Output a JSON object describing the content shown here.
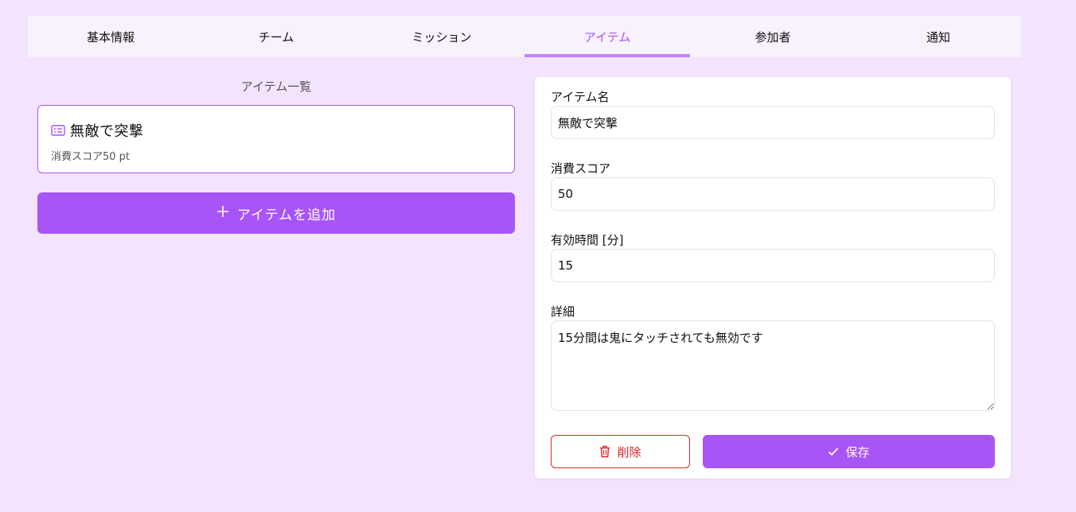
{
  "tabs": [
    {
      "label": "基本情報"
    },
    {
      "label": "チーム"
    },
    {
      "label": "ミッション"
    },
    {
      "label": "アイテム",
      "active": true
    },
    {
      "label": "参加者"
    },
    {
      "label": "通知"
    }
  ],
  "item_list": {
    "title": "アイテム一覧",
    "items": [
      {
        "icon": "id-card-icon",
        "name": "無敵で突撃",
        "cost_text": "消費スコア50 pt"
      }
    ],
    "add_button_label": "アイテムを追加",
    "add_icon": "plus-icon"
  },
  "form": {
    "name_label": "アイテム名",
    "name_value": "無敵で突撃",
    "score_label": "消費スコア",
    "score_value": "50",
    "duration_label": "有効時間 [分]",
    "duration_value": "15",
    "detail_label": "詳細",
    "detail_value": "15分間は鬼にタッチされても無効です",
    "delete_label": "削除",
    "delete_icon": "trash-icon",
    "save_label": "保存",
    "save_icon": "check-icon"
  },
  "colors": {
    "background": "#f3e3fd",
    "accent": "#a855f7",
    "danger": "#dc2626"
  }
}
